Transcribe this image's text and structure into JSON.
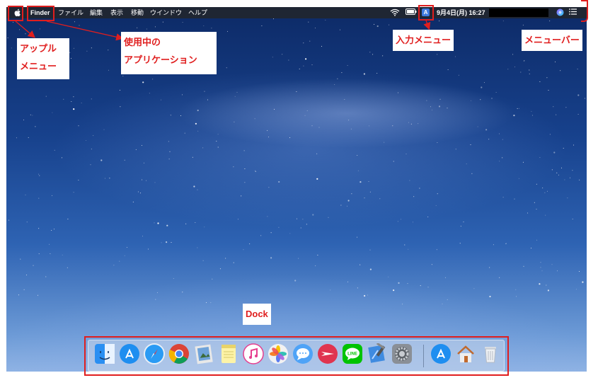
{
  "menubar": {
    "app_name": "Finder",
    "menus": [
      "ファイル",
      "編集",
      "表示",
      "移動",
      "ウインドウ",
      "ヘルプ"
    ],
    "input_indicator": "A",
    "datetime": "9月4日(月) 16:27",
    "icons": [
      "apple-logo",
      "wifi",
      "battery",
      "input-source",
      "siri",
      "notification-list"
    ]
  },
  "labels": {
    "apple_menu_line1": "アップル",
    "apple_menu_line2": "メニュー",
    "active_app_line1": "使用中の",
    "active_app_line2": "アプリケーション",
    "input_menu": "入力メニュー",
    "menu_bar": "メニューバー",
    "dock": "Dock"
  },
  "colors": {
    "annotation": "#e01e1e",
    "menubar": "#1f2633"
  },
  "dock": {
    "apps": [
      "finder",
      "app-store",
      "safari",
      "chrome",
      "preview",
      "notes",
      "itunes",
      "photos",
      "messages",
      "airmail",
      "line",
      "xcode",
      "system-preferences",
      "app-store-download",
      "home-folder",
      "trash"
    ]
  }
}
